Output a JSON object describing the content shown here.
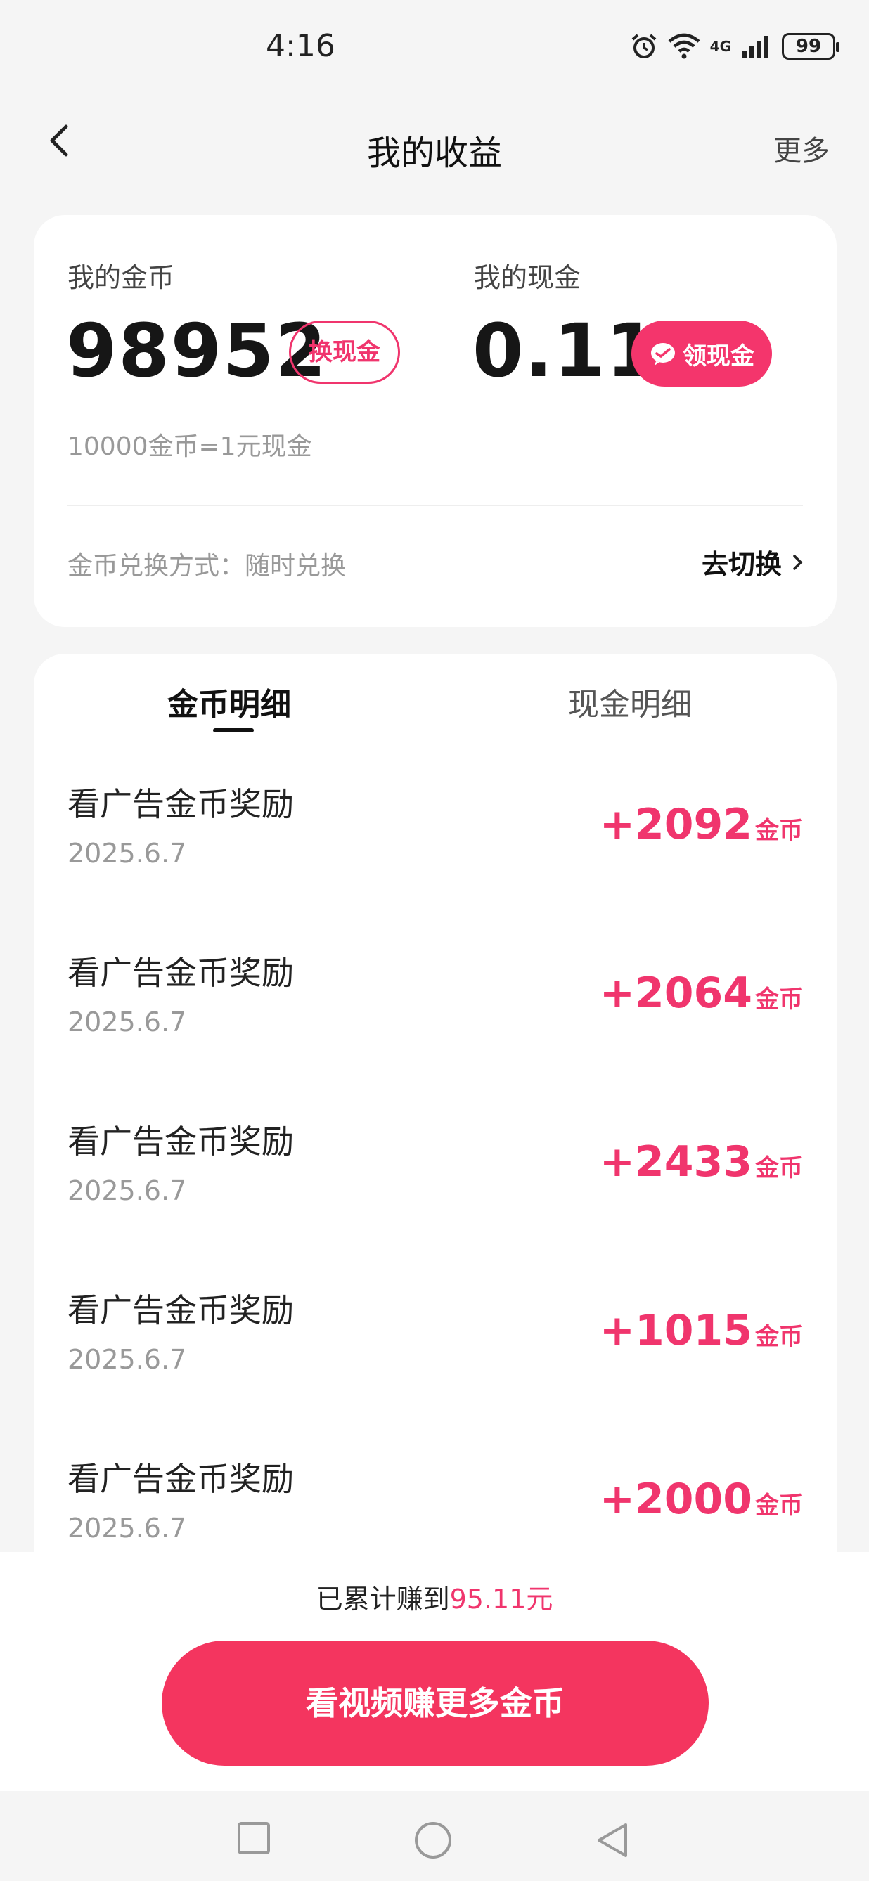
{
  "status_bar": {
    "time": "4:16",
    "network": "4G",
    "battery": "99"
  },
  "nav": {
    "title": "我的收益",
    "more": "更多"
  },
  "earnings": {
    "coins_label": "我的金币",
    "coins_value": "98952",
    "exchange_button": "换现金",
    "cash_label": "我的现金",
    "cash_value": "0.11",
    "withdraw_button": "领现金",
    "rate_text": "10000金币=1元现金",
    "method_text": "金币兑换方式：随时兑换",
    "switch_text": "去切换"
  },
  "details": {
    "tabs": [
      {
        "label": "金币明细",
        "active": true
      },
      {
        "label": "现金明细",
        "active": false
      }
    ],
    "rows": [
      {
        "title": "看广告金币奖励",
        "date": "2025.6.7",
        "amount": "+2092",
        "unit": "金币"
      },
      {
        "title": "看广告金币奖励",
        "date": "2025.6.7",
        "amount": "+2064",
        "unit": "金币"
      },
      {
        "title": "看广告金币奖励",
        "date": "2025.6.7",
        "amount": "+2433",
        "unit": "金币"
      },
      {
        "title": "看广告金币奖励",
        "date": "2025.6.7",
        "amount": "+1015",
        "unit": "金币"
      },
      {
        "title": "看广告金币奖励",
        "date": "2025.6.7",
        "amount": "+2000",
        "unit": "金币"
      }
    ]
  },
  "footer": {
    "total_prefix": "已累计赚到",
    "total_value": "95.11元",
    "cta": "看视频赚更多金币"
  },
  "colors": {
    "accent": "#f0356d",
    "background": "#f5f5f5"
  },
  "icons": {
    "status": [
      "alarm-icon",
      "wifi-icon",
      "signal-icon",
      "battery-icon"
    ],
    "nav": [
      "back-icon"
    ],
    "system_nav": [
      "square-icon",
      "circle-icon",
      "triangle-back-icon"
    ]
  }
}
